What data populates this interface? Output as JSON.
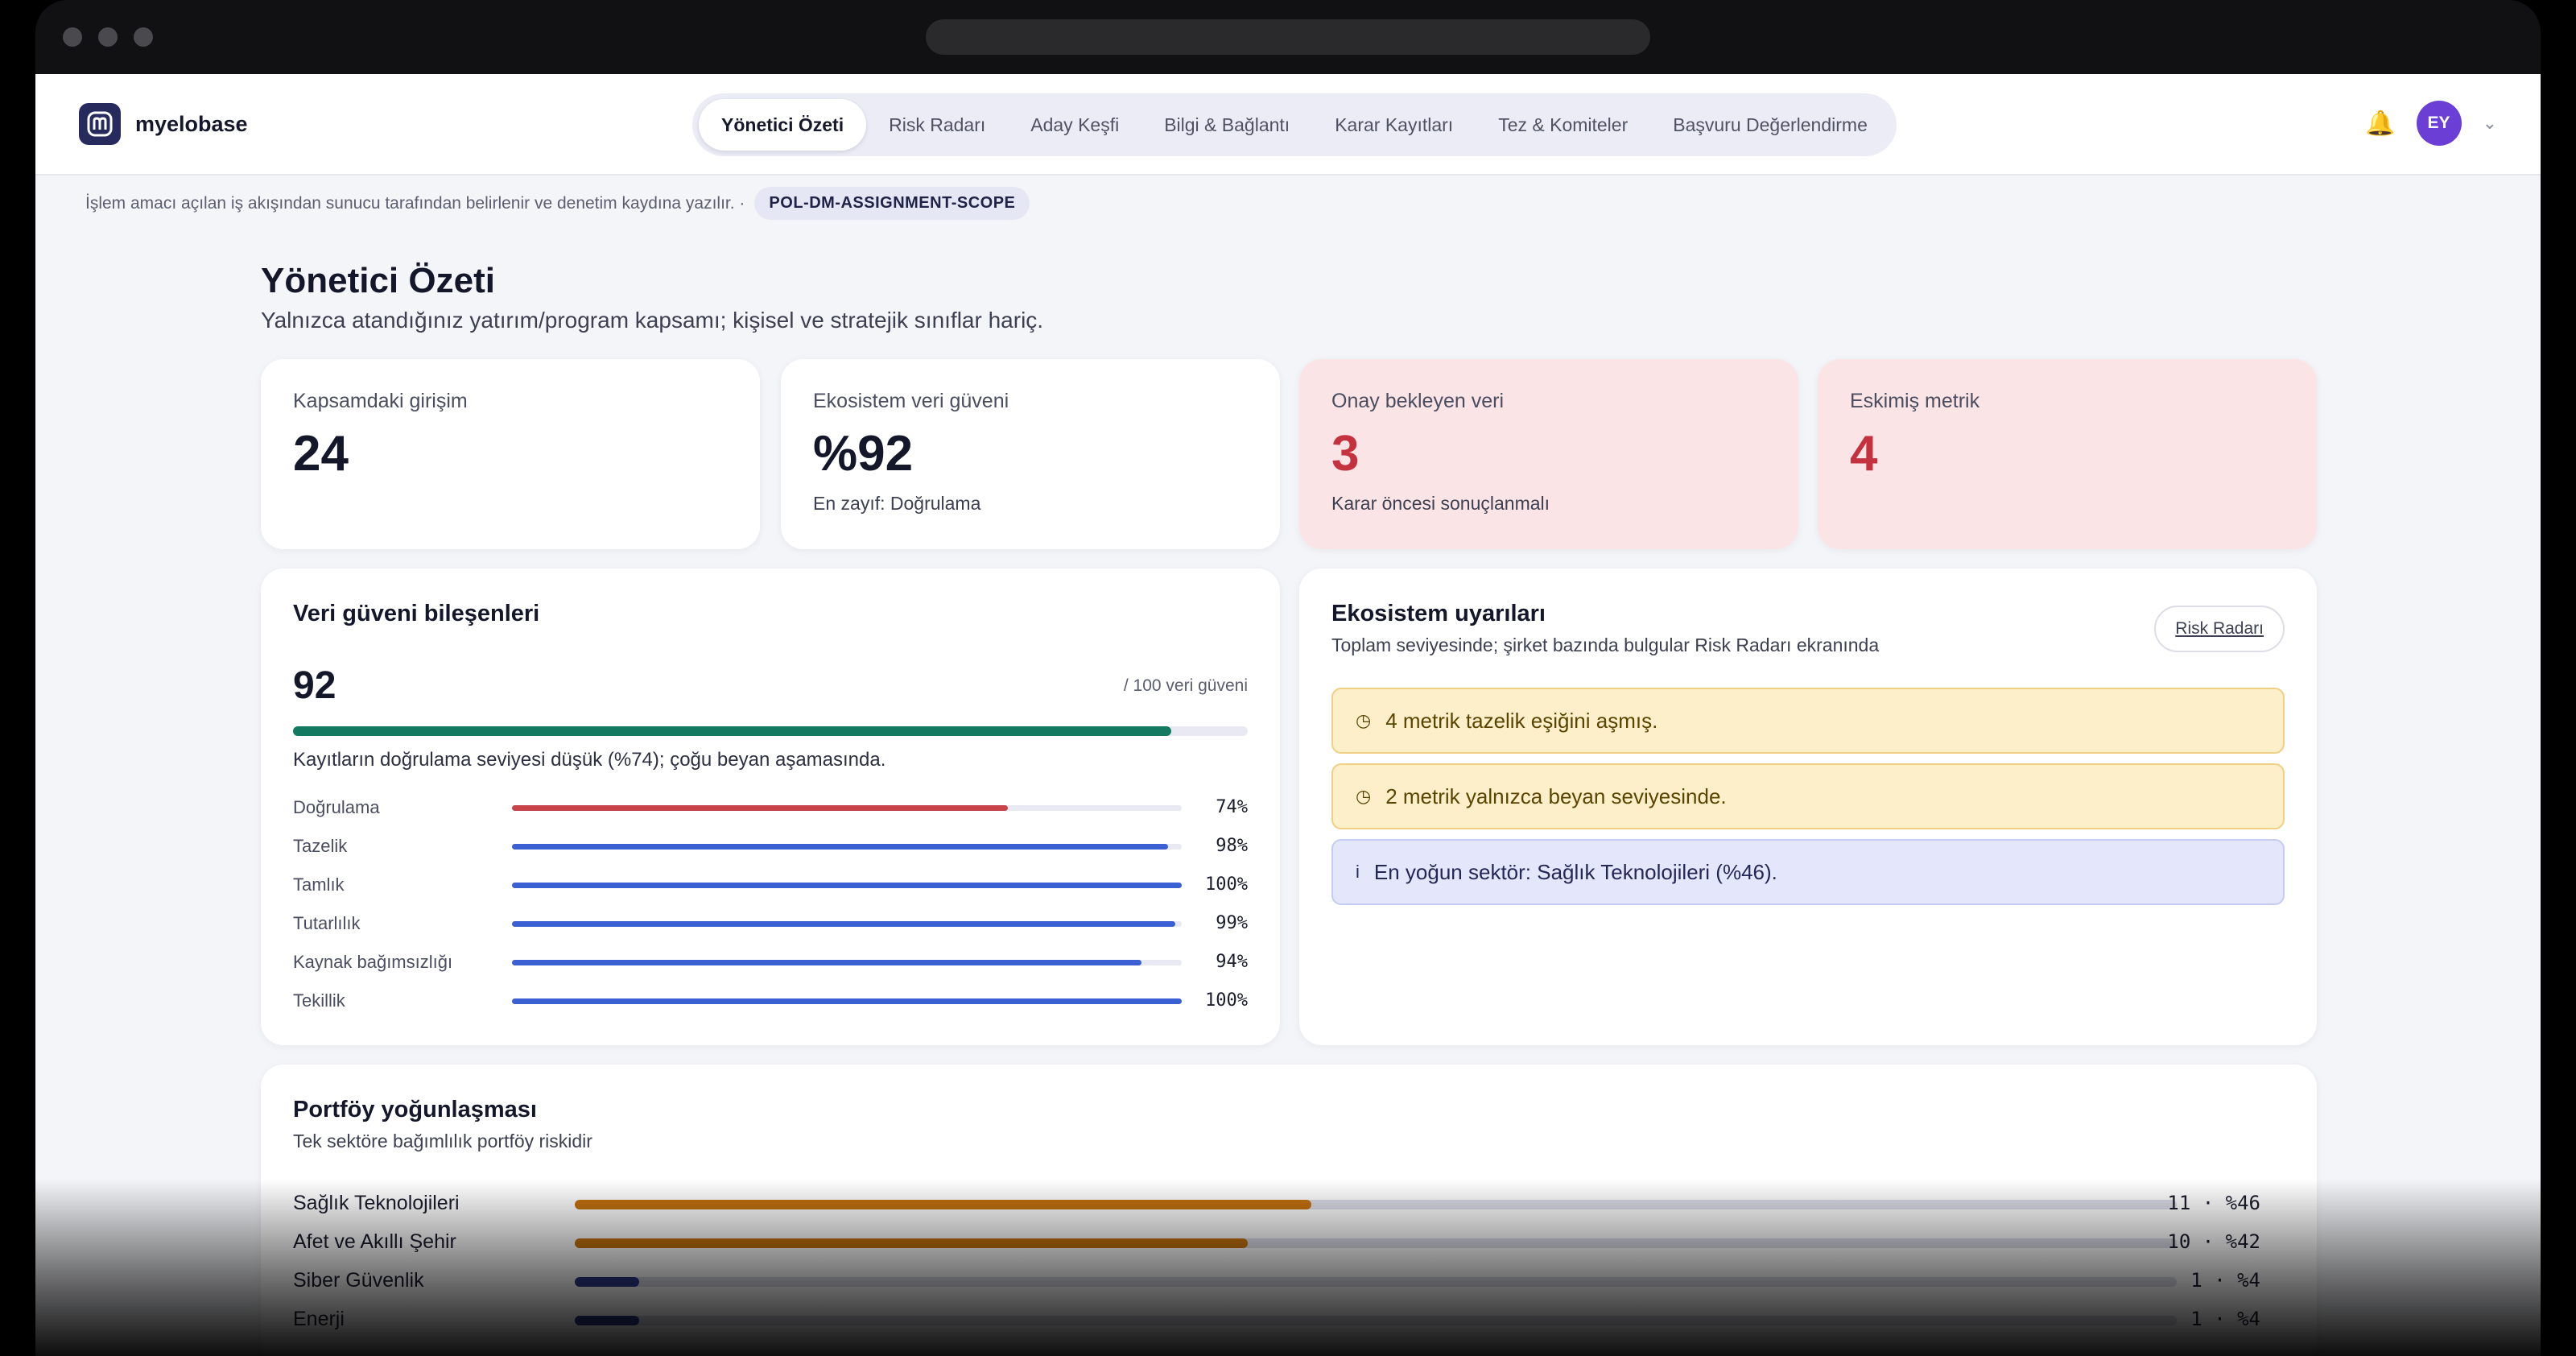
{
  "brand": {
    "name": "myelobase",
    "logo_icon": "brand-logo-icon"
  },
  "nav": {
    "tabs": [
      {
        "label": "Yönetici Özeti",
        "active": true
      },
      {
        "label": "Risk Radarı",
        "active": false
      },
      {
        "label": "Aday Keşfi",
        "active": false
      },
      {
        "label": "Bilgi & Bağlantı",
        "active": false
      },
      {
        "label": "Karar Kayıtları",
        "active": false
      },
      {
        "label": "Tez & Komiteler",
        "active": false
      },
      {
        "label": "Başvuru Değerlendirme",
        "active": false
      }
    ],
    "bell_icon": "bell-icon",
    "avatar_initials": "EY",
    "caret": "⌄"
  },
  "scope": {
    "text": "İşlem amacı açılan iş akışından sunucu tarafından belirlenir ve denetim kaydına yazılır. ·",
    "badge": "POL-DM-ASSIGNMENT-SCOPE"
  },
  "page": {
    "title": "Yönetici Özeti",
    "subtitle": "Yalnızca atandığınız yatırım/program kapsamı; kişisel ve stratejik sınıflar hariç."
  },
  "kpis": [
    {
      "label": "Kapsamdaki girişim",
      "value": "24",
      "note": "",
      "alert": false
    },
    {
      "label": "Ekosistem veri güveni",
      "value": "%92",
      "note": "En zayıf: Doğrulama",
      "alert": false
    },
    {
      "label": "Onay bekleyen veri",
      "value": "3",
      "note": "Karar öncesi sonuçlanmalı",
      "alert": true
    },
    {
      "label": "Eskimiş metrik",
      "value": "4",
      "note": "",
      "alert": true
    }
  ],
  "trust": {
    "title": "Veri güveni bileşenleri",
    "score": "92",
    "score_of": "/ 100 veri güveni",
    "score_fraction": 0.92,
    "note": "Kayıtların doğrulama seviyesi düşük (%74); çoğu beyan aşamasında.",
    "components": [
      {
        "label": "Doğrulama",
        "value": "74%",
        "pct": 74,
        "color": "#c9434b"
      },
      {
        "label": "Tazelik",
        "value": "98%",
        "pct": 98,
        "color": "#3c5fd3"
      },
      {
        "label": "Tamlık",
        "value": "100%",
        "pct": 100,
        "color": "#3c5fd3"
      },
      {
        "label": "Tutarlılık",
        "value": "99%",
        "pct": 99,
        "color": "#3c5fd3"
      },
      {
        "label": "Kaynak bağımsızlığı",
        "value": "94%",
        "pct": 94,
        "color": "#3c5fd3"
      },
      {
        "label": "Tekillik",
        "value": "100%",
        "pct": 100,
        "color": "#3c5fd3"
      }
    ]
  },
  "alerts": {
    "title": "Ekosistem uyarıları",
    "subtitle": "Toplam seviyesinde; şirket bazında bulgular Risk Radarı ekranında",
    "button": "Risk Radarı",
    "items": [
      {
        "type": "warn",
        "icon": "◷",
        "text": "4 metrik tazelik eşiğini aşmış."
      },
      {
        "type": "warn",
        "icon": "◷",
        "text": "2 metrik yalnızca beyan seviyesinde."
      },
      {
        "type": "info",
        "icon": "i",
        "text": "En yoğun sektör: Sağlık Teknolojileri (%46)."
      }
    ]
  },
  "portfolio": {
    "title": "Portföy yoğunlaşması",
    "subtitle": "Tek sektöre bağımlılık portföy riskidir",
    "rows": [
      {
        "label": "Sağlık Teknolojileri",
        "value": "11 · %46",
        "pct": 46,
        "color": "#c4720f"
      },
      {
        "label": "Afet ve Akıllı Şehir",
        "value": "10 · %42",
        "pct": 42,
        "color": "#c4720f"
      },
      {
        "label": "Siber Güvenlik",
        "value": " 1 · %4",
        "pct": 4,
        "color": "#2d3a8c"
      },
      {
        "label": "Enerji",
        "value": " 1 · %4",
        "pct": 4,
        "color": "#2d3a8c"
      }
    ]
  }
}
